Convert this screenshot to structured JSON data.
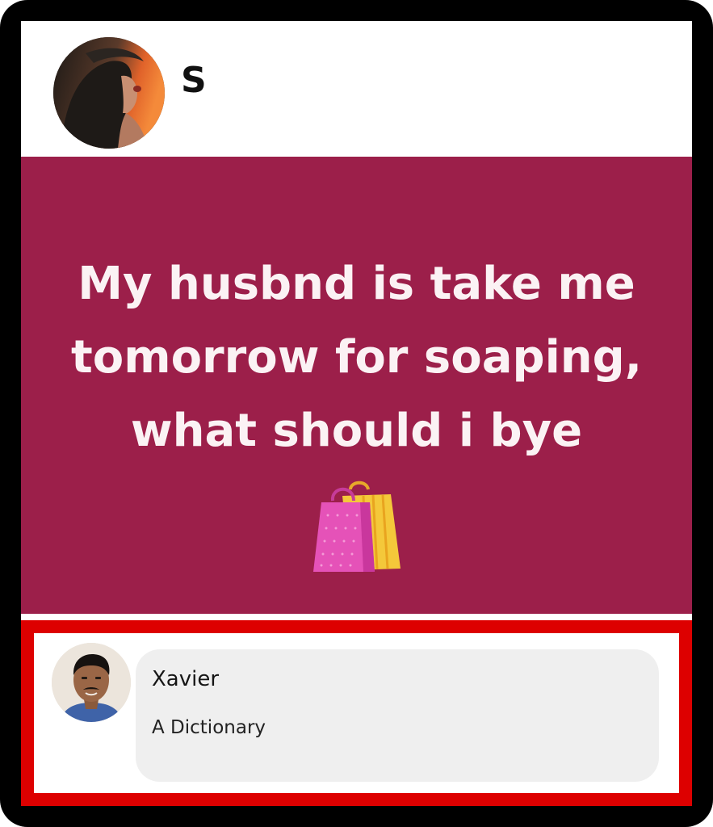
{
  "post": {
    "author_name": "S",
    "text": "My husbnd is take me\ntomorrow for soaping,\nwhat should i bye",
    "emoji_icon": "shopping-bags-icon",
    "background_color": "#9c1f4a"
  },
  "comment": {
    "author_name": "Xavier",
    "text": "A Dictionary",
    "highlight_color": "#dd0000"
  }
}
